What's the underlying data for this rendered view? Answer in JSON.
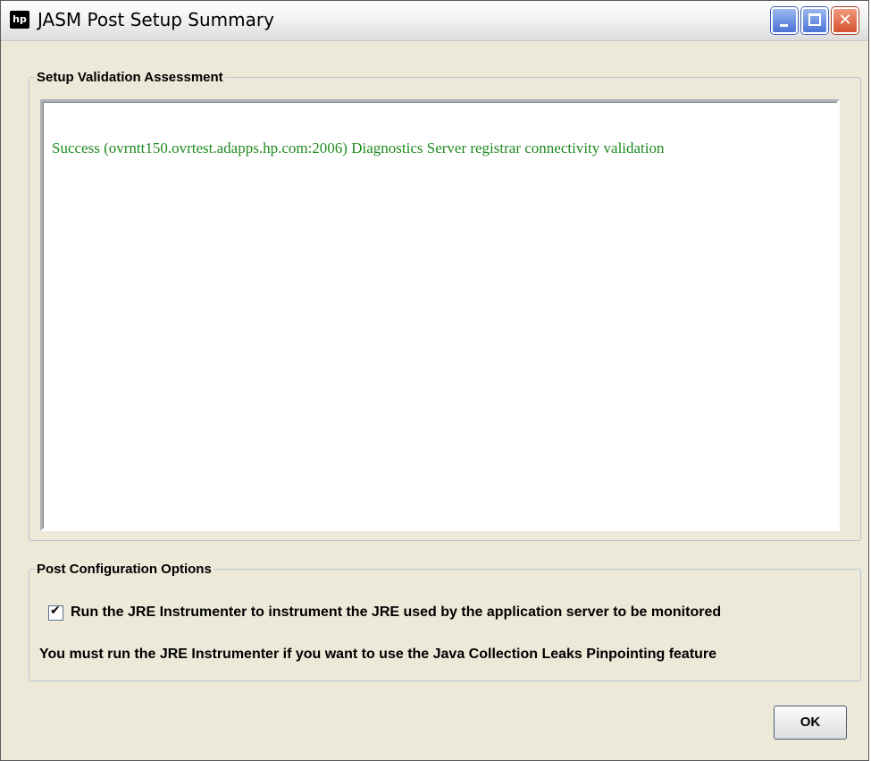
{
  "window": {
    "title": "JASM Post Setup Summary",
    "app_icon": "hp-logo-icon"
  },
  "validation": {
    "legend": "Setup Validation Assessment",
    "message": "Success (ovrntt150.ovrtest.adapps.hp.com:2006) Diagnostics Server registrar connectivity validation",
    "message_color": "#1f8a1f"
  },
  "options": {
    "legend": "Post Configuration Options",
    "checkbox_label": "Run the JRE Instrumenter to instrument the JRE used by the application server to be monitored",
    "checkbox_checked": true,
    "note": "You must run the JRE Instrumenter if you want to use the Java Collection Leaks Pinpointing feature"
  },
  "buttons": {
    "ok": "OK"
  }
}
